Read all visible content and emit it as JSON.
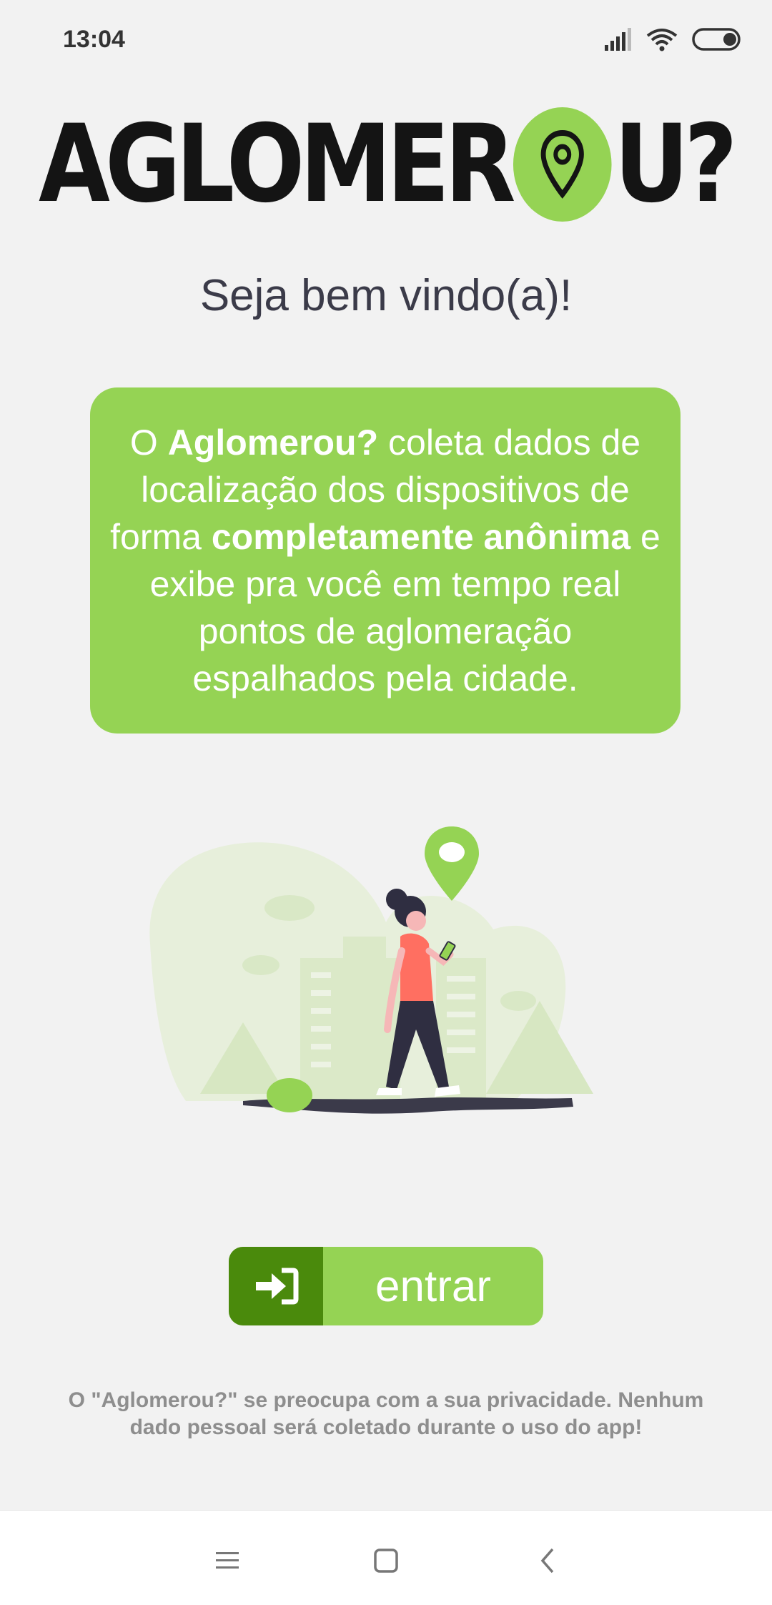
{
  "status_bar": {
    "time": "13:04"
  },
  "logo": {
    "part1": "AGLOMER",
    "part2": "U?",
    "pin_color": "#95d354"
  },
  "welcome": {
    "title": "Seja bem vindo(a)!"
  },
  "info_card": {
    "t1": "O ",
    "b1": "Aglomerou?",
    "t2": " coleta dados de localização dos dispositivos de forma ",
    "b2": "completamente anônima",
    "t3": " e exibe pra você em tempo real pontos de aglomeração espalhados pela cidade.",
    "background": "#95d354"
  },
  "enter_button": {
    "label": "entrar",
    "icon": "sign-in-icon",
    "accent": "#4a8a0c"
  },
  "privacy": {
    "text": "O \"Aglomerou?\" se preocupa com a sua privacidade. Nenhum dado pessoal será coletado durante o uso do app!"
  },
  "nav_bar": {
    "buttons": [
      "menu-icon",
      "home-icon",
      "back-icon"
    ]
  }
}
